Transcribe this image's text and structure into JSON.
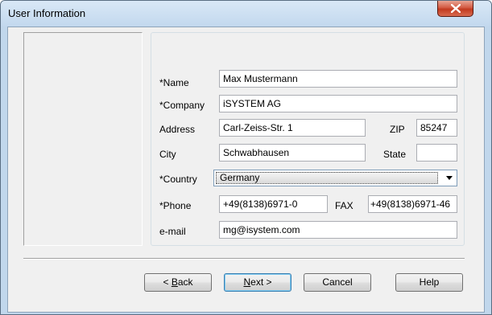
{
  "window": {
    "title": "User Information",
    "close_glyph": "✕"
  },
  "form": {
    "name": {
      "label": "*Name",
      "value": "Max Mustermann"
    },
    "company": {
      "label": "*Company",
      "value": "iSYSTEM AG"
    },
    "address": {
      "label": "Address",
      "value": "Carl-Zeiss-Str. 1"
    },
    "zip": {
      "label": "ZIP",
      "value": "85247"
    },
    "city": {
      "label": "City",
      "value": "Schwabhausen"
    },
    "state": {
      "label": "State",
      "value": ""
    },
    "country": {
      "label": "*Country",
      "value": "Germany"
    },
    "phone": {
      "label": "*Phone",
      "value": "+49(8138)6971-0"
    },
    "fax": {
      "label": "FAX",
      "value": "+49(8138)6971-46"
    },
    "email": {
      "label": "e-mail",
      "value": "mg@isystem.com"
    }
  },
  "buttons": {
    "back": {
      "mnemonic": "B",
      "rest": "ack",
      "prefix": "< "
    },
    "next": {
      "mnemonic": "N",
      "rest": "ext >"
    },
    "cancel": {
      "label": "Cancel"
    },
    "help": {
      "label": "Help"
    }
  },
  "icons": {
    "close": "close-icon",
    "dropdown": "chevron-down-icon"
  }
}
